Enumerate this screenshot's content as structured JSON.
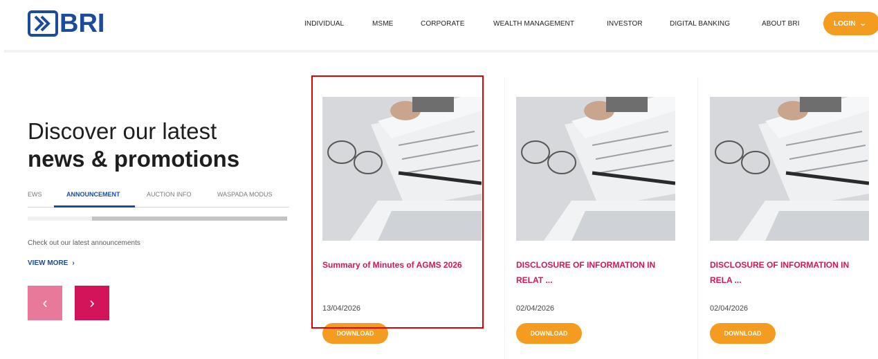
{
  "header": {
    "logo_text": "BRI",
    "nav": [
      "INDIVIDUAL",
      "MSME",
      "CORPORATE",
      "WEALTH MANAGEMENT",
      "INVESTOR",
      "DIGITAL BANKING",
      "ABOUT BRI"
    ],
    "login_label": "LOGIN"
  },
  "left": {
    "heading_line1": "Discover our latest",
    "heading_line2": "news & promotions",
    "tabs": [
      "EWS",
      "ANNOUNCEMENT",
      "AUCTION INFO",
      "WASPADA MODUS"
    ],
    "active_tab": "ANNOUNCEMENT",
    "description": "Check out our latest announcements",
    "view_more": "VIEW MORE",
    "prev_label": "‹",
    "next_label": "›"
  },
  "cards": [
    {
      "title": "Summary of Minutes of AGMS 2026",
      "date": "13/04/2026",
      "button": "DOWNLOAD"
    },
    {
      "title": "DISCLOSURE OF INFORMATION IN RELAT ...",
      "date": "02/04/2026",
      "button": "DOWNLOAD"
    },
    {
      "title": "DISCLOSURE OF INFORMATION IN RELA ...",
      "date": "02/04/2026",
      "button": "DOWNLOAD"
    }
  ],
  "colors": {
    "brand_blue": "#1a4b9c",
    "accent_orange": "#f39c1f",
    "accent_pink": "#d4145a",
    "highlight_red": "#e00000"
  }
}
